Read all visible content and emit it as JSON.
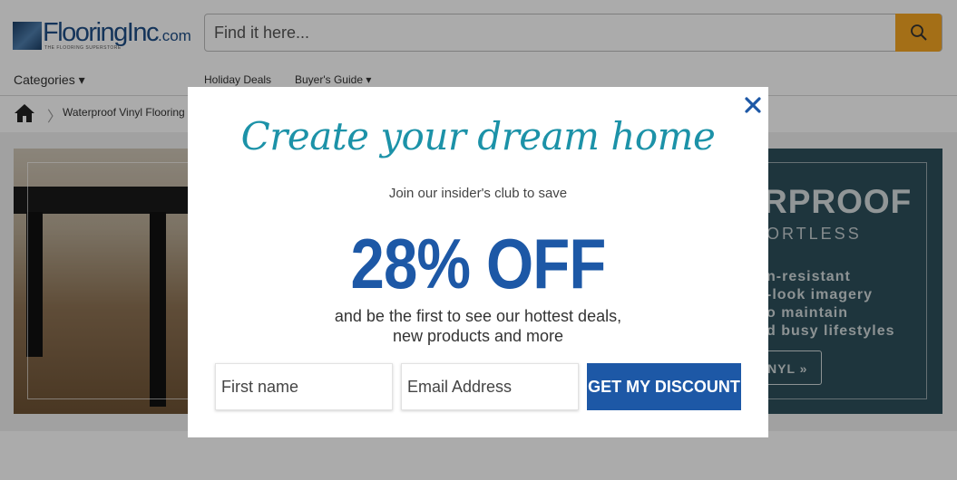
{
  "header": {
    "logo_word": "FlooringInc",
    "logo_suffix": ".com",
    "logo_tagline": "THE FLOORING SUPERSTORE",
    "search": {
      "placeholder": "Find it here..."
    }
  },
  "nav": {
    "categories": "Categories ▾",
    "holiday_deals": "Holiday Deals",
    "buyers_guide": "Buyer's Guide ▾"
  },
  "breadcrumb": {
    "separator": "〉",
    "current": "Waterproof Vinyl Flooring"
  },
  "hero_banner": {
    "title": "RPROOF",
    "subtitle": "ORTLESS",
    "bullets": [
      "n-resistant",
      "-look imagery",
      "o maintain",
      "d busy lifestyles"
    ],
    "cta": "NYL »"
  },
  "popup": {
    "headline": "Create your dream home",
    "subheadline": "Join our insider's club to save",
    "discount": "28% OFF",
    "description_line1": "and be the first to see our hottest deals,",
    "description_line2": "new products and more",
    "first_name_placeholder": "First name",
    "email_placeholder": "Email Address",
    "submit_label": "GET MY DISCOUNT"
  },
  "colors": {
    "brand_blue": "#1d58a6",
    "headline_teal": "#1c92a8",
    "search_button": "#f5a623",
    "close_icon": "#1d58a6"
  }
}
